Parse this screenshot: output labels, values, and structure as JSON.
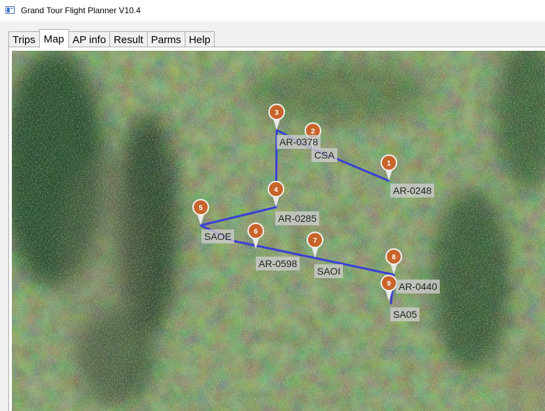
{
  "window": {
    "title": "Grand Tour Flight Planner V10.4"
  },
  "tabs": [
    {
      "label": "Trips",
      "active": false
    },
    {
      "label": "Map",
      "active": true
    },
    {
      "label": "AP info",
      "active": false
    },
    {
      "label": "Result",
      "active": false
    },
    {
      "label": "Parms",
      "active": false
    },
    {
      "label": "Help",
      "active": false
    }
  ],
  "map": {
    "route_color": "#3a3fd4",
    "marker_color": "#c8642a",
    "markers": [
      "1",
      "2",
      "3",
      "4",
      "5",
      "6",
      "7",
      "8",
      "9"
    ],
    "airports": [
      "AR-0248",
      "CSA",
      "AR-0378",
      "AR-0285",
      "SAOE",
      "AR-0598",
      "SAOI",
      "AR-0440",
      "SA05"
    ]
  }
}
